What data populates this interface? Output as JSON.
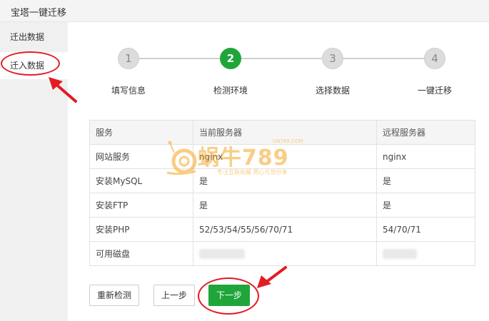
{
  "window": {
    "title": "宝塔一键迁移"
  },
  "sidebar": {
    "items": [
      {
        "label": "迁出数据"
      },
      {
        "label": "迁入数据"
      }
    ]
  },
  "steps": [
    {
      "number": "1",
      "label": "填写信息"
    },
    {
      "number": "2",
      "label": "检测环境"
    },
    {
      "number": "3",
      "label": "选择数据"
    },
    {
      "number": "4",
      "label": "一键迁移"
    }
  ],
  "table": {
    "headers": [
      "服务",
      "当前服务器",
      "远程服务器"
    ],
    "rows": [
      [
        "网站服务",
        "nginx",
        "nginx"
      ],
      [
        "安装MySQL",
        "是",
        "是"
      ],
      [
        "安装FTP",
        "是",
        "是"
      ],
      [
        "安装PHP",
        "52/53/54/55/56/70/71",
        "54/70/71"
      ],
      [
        "可用磁盘",
        "",
        ""
      ]
    ]
  },
  "buttons": {
    "recheck": "重新检测",
    "prev": "上一步",
    "next": "下一步"
  },
  "watermark": {
    "brand": "蜗牛789",
    "domain": "UN789.COM",
    "slogan": "专注互联收藏  用心与您分享"
  },
  "colors": {
    "accent": "#20a53a",
    "annotation": "#e31b23",
    "watermark": "#f5a623"
  }
}
